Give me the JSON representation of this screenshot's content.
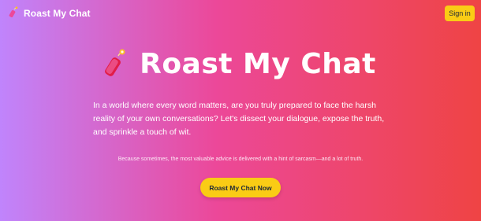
{
  "navbar": {
    "brand_icon": "firecracker-icon",
    "brand_label": "Roast My Chat",
    "signin_label": "Sign in"
  },
  "hero": {
    "icon": "firecracker-icon",
    "title": "Roast My Chat",
    "description": "In a world where every word matters, are you truly prepared to face the harsh reality of your own conversations? Let's dissect your dialogue, expose the truth, and sprinkle a touch of wit.",
    "subtitle": "Because sometimes, the most valuable advice is delivered with a hint of sarcasm—and a lot of truth.",
    "cta_label": "Roast My Chat Now"
  },
  "colors": {
    "gradient_start": "#c084fc",
    "gradient_mid": "#ec4899",
    "gradient_end": "#ef4444",
    "accent": "#facc15"
  }
}
